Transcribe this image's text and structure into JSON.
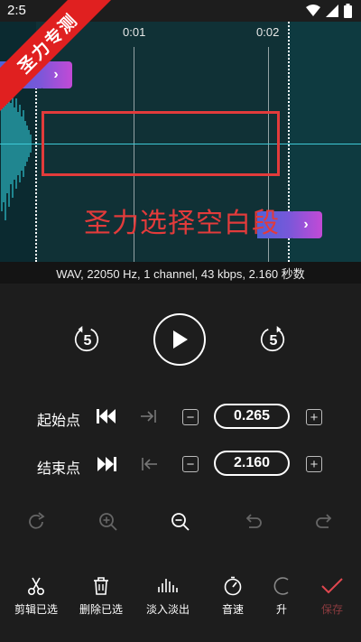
{
  "status": {
    "time": "2:5",
    "icons": [
      "wifi-icon",
      "signal-icon",
      "battery-icon"
    ]
  },
  "ribbon": {
    "text": "圣力专测"
  },
  "timeline": {
    "tick_1": "0:01",
    "tick_2": "0:02"
  },
  "overlay": {
    "annotation": "圣力选择空白段"
  },
  "info": {
    "text": "WAV, 22050 Hz, 1 channel, 43 kbps, 2.160 秒数"
  },
  "transport": {
    "rewind_seconds": "5",
    "forward_seconds": "5"
  },
  "start_row": {
    "label": "起始点",
    "value": "0.265"
  },
  "end_row": {
    "label": "结束点",
    "value": "2.160"
  },
  "nav": {
    "cut": "剪辑已选",
    "delete": "删除已选",
    "fade": "淡入淡出",
    "volume": "音速",
    "upgrade": "升",
    "save": "保存"
  },
  "colors": {
    "accent_cyan": "#3ec9d6",
    "marker_purple": "#7b57d9",
    "annotation_red": "#e23b3b",
    "save_red": "#e0474f"
  }
}
